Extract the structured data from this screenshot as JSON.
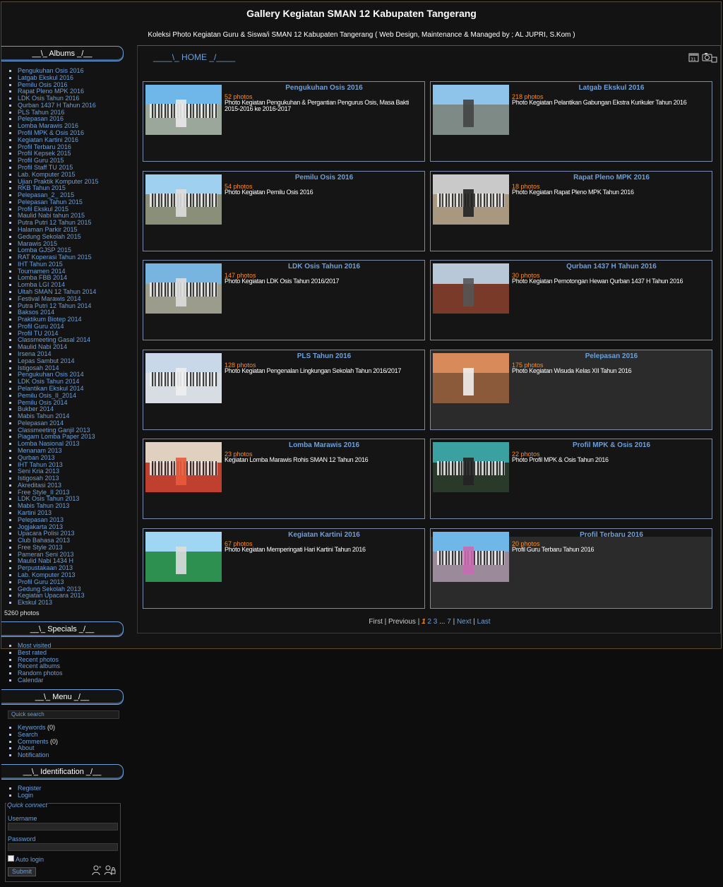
{
  "header": {
    "title": "Gallery Kegiatan SMAN 12 Kabupaten Tangerang",
    "subtitle": "Koleksi Photo Kegiatan Guru & Siswa/i SMAN 12 Kabupaten Tangerang ( Web Design, Maintenance & Managed by ; AL JUPRI, S.Kom )"
  },
  "albums_box": {
    "title": "__\\_ Albums _/__",
    "items": [
      "Pengukuhan Osis 2016",
      "Latgab Ekskul 2016",
      "Pemilu Osis 2016",
      "Rapat Pleno MPK 2016",
      "LDK Osis Tahun 2016",
      "Qurban 1437 H Tahun 2016",
      "PLS Tahun 2016",
      "Pelepasan 2016",
      "Lomba Marawis 2016",
      "Profil MPK & Osis 2016",
      "Kegiatan Kartini 2016",
      "Profil Terbaru 2016",
      "Profil Kepsek 2015",
      "Profil Guru 2015",
      "Profil Staff TU 2015",
      "Lab. Komputer 2015",
      "Ujian Praktik Komputer 2015",
      "RKB Tahun 2015",
      "Pelepasan_2_ 2015",
      "Pelepasan Tahun 2015",
      "Profil Ekskul 2015",
      "Maulid Nabi tahun 2015",
      "Putra Putri 12 Tahun 2015",
      "Halaman Parkir 2015",
      "Gedung Sekolah 2015",
      "Marawis 2015",
      "Lomba GJSP 2015",
      "RAT Koperasi Tahun 2015",
      "IHT Tahun 2015",
      "Tournamen 2014",
      "Lomba FBB 2014",
      "Lomba LGI 2014",
      "Ultah SMAN 12 Tahun 2014",
      "Festival Marawis 2014",
      "Putra Putri 12 Tahun 2014",
      "Baksos 2014",
      "Praktikum Biotep 2014",
      "Profil Guru 2014",
      "Profil TU 2014",
      "Classmeeting Gasal 2014",
      "Maulid Nabi 2014",
      "Irsena 2014",
      "Lepas Sambut 2014",
      "Istigosah 2014",
      "Pengukuhan Osis 2014",
      "LDK Osis Tahun 2014",
      "Pelantikan Ekskul 2014",
      "Pemilu Osis_II_2014",
      "Pemilu Osis 2014",
      "Bukber 2014",
      "Mabis Tahun 2014",
      "Pelepasan 2014",
      "Classmeeting Ganjil 2013",
      "Piagam Lomba Paper 2013",
      "Lomba Nasional 2013",
      "Menanam 2013",
      "Qurban 2013",
      "IHT Tahun 2013",
      "Seni Kria 2013",
      "Istigosah 2013",
      "Akreditasi 2013",
      "Free Style_II 2013",
      "LDK Osis Tahun 2013",
      "Mabis Tahun 2013",
      "Kartini 2013",
      "Pelepasan 2013",
      "Jogjakarta 2013",
      "Upacara Polisi 2013",
      "Club Bahasa 2013",
      "Free Style 2013",
      "Pameran Seni 2013",
      "Maulid Nabi 1434 H",
      "Perpustakaan 2013",
      "Lab. Komputer 2013",
      "Profil Guru 2013",
      "Gedung Sekolah 2013",
      "Kegiatan Upacara 2013",
      "Ekskul 2013"
    ],
    "total": "5260 photos"
  },
  "specials_box": {
    "title": "__\\_ Specials _/__",
    "items": [
      "Most visited",
      "Best rated",
      "Recent photos",
      "Recent albums",
      "Random photos",
      "Calendar"
    ]
  },
  "menu_box": {
    "title": "__\\_ Menu _/__",
    "quick_search_placeholder": "Quick search",
    "items": [
      {
        "label": "Keywords",
        "count": " (0)"
      },
      {
        "label": "Search",
        "count": ""
      },
      {
        "label": "Comments",
        "count": " (0)"
      },
      {
        "label": "About",
        "count": ""
      },
      {
        "label": "Notification",
        "count": ""
      }
    ]
  },
  "identification_box": {
    "title": "__\\_ Identification _/__",
    "items": [
      "Register",
      "Login"
    ],
    "quick_connect": {
      "legend": "Quick connect",
      "username_label": "Username",
      "password_label": "Password",
      "autologin_label": "Auto login",
      "submit_label": "Submit"
    }
  },
  "content": {
    "home_label": "____\\_ HOME _/____",
    "albums": [
      {
        "title": "Pengukuhan Osis 2016",
        "count": "52 photos",
        "desc": "Photo Kegiatan Pengukuhan & Pergantian Pengurus Osis, Masa Bakti 2015-2016 ke 2016-2017"
      },
      {
        "title": "Latgab Ekskul 2016",
        "count": "218 photos",
        "desc": "Photo Kegiatan Pelantikan Gabungan Ekstra Kurikuler Tahun 2016"
      },
      {
        "title": "Pemilu Osis 2016",
        "count": "54 photos",
        "desc": "Photo Kegiatan Pemilu Osis 2016"
      },
      {
        "title": "Rapat Pleno MPK 2016",
        "count": "18 photos",
        "desc": "Photo Kegiatan Rapat Pleno MPK Tahun 2016"
      },
      {
        "title": "LDK Osis Tahun 2016",
        "count": "147 photos",
        "desc": "Photo Kegiatan LDK Osis Tahun 2016/2017"
      },
      {
        "title": "Qurban 1437 H Tahun 2016",
        "count": "30 photos",
        "desc": "Photo Kegiatan Pemotongan Hewan Qurban 1437 H Tahun 2016"
      },
      {
        "title": "PLS Tahun 2016",
        "count": "128 photos",
        "desc": "Photo Kegiatan Pengenalan Lingkungan Sekolah Tahun 2016/2017"
      },
      {
        "title": "Pelepasan 2016",
        "count": "175 photos",
        "desc": "Photo Kegiatan Wisuda Kelas XII Tahun 2016"
      },
      {
        "title": "Lomba Marawis 2016",
        "count": "23 photos",
        "desc": "Kegiatan Lomba Marawis Rohis SMAN 12 Tahun 2016"
      },
      {
        "title": "Profil MPK & Osis 2016",
        "count": "22 photos",
        "desc": "Photo Profil MPK & Osis Tahun 2016"
      },
      {
        "title": "Kegiatan Kartini 2016",
        "count": "67 photos",
        "desc": "Photo Kegiatan Memperingati Hari Kartini Tahun 2016"
      },
      {
        "title": "Profil Terbaru 2016",
        "count": "20 photos",
        "desc": "Profil Guru Terbaru Tahun 2016"
      }
    ],
    "pager": {
      "first": "First",
      "sep1": " | ",
      "previous": "Previous",
      "sep2": " | ",
      "current": "1",
      "p2": "2",
      "p3": "3",
      "ellipsis": " ... ",
      "p7": "7",
      "sep3": " | ",
      "next": "Next",
      "sep4": " | ",
      "last": "Last"
    }
  },
  "colors": {
    "link": "#6d9fd8",
    "count": "#ff8c1a",
    "background": "#0d0d0d"
  }
}
